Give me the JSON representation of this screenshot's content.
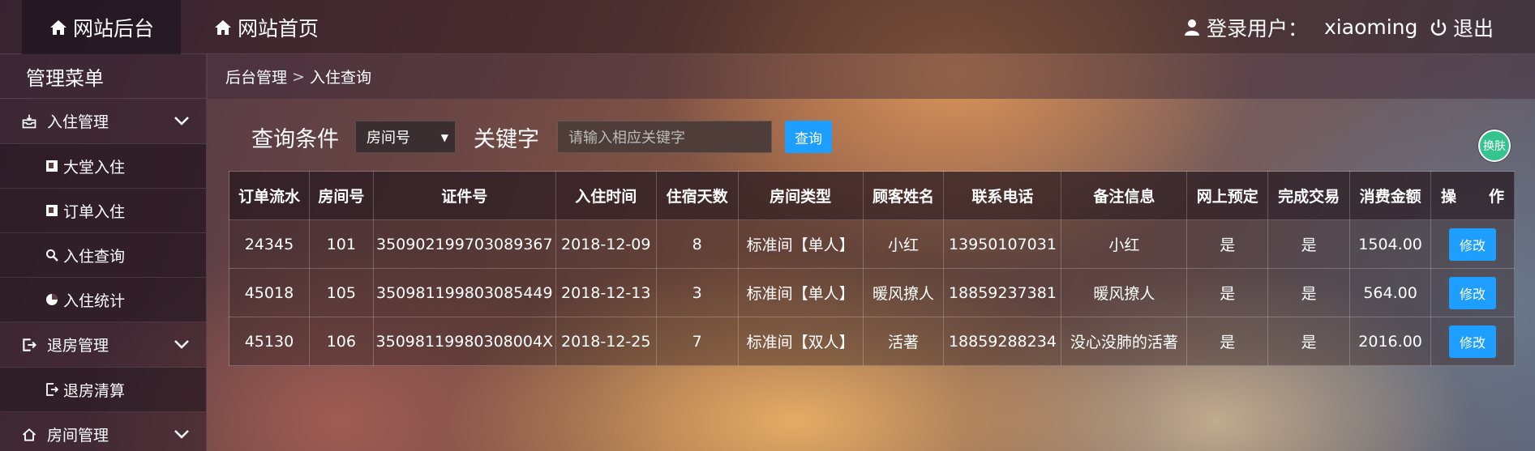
{
  "topbar": {
    "home_tab": "网站后台",
    "site_tab": "网站首页",
    "user_label": "登录用户：",
    "username": "xiaoming",
    "logout": "退出"
  },
  "sidebar": {
    "title": "管理菜单",
    "groups": [
      {
        "label": "入住管理",
        "items": [
          "大堂入住",
          "订单入住",
          "入住查询",
          "入住统计"
        ]
      },
      {
        "label": "退房管理",
        "items": [
          "退房清算"
        ]
      },
      {
        "label": "房间管理",
        "items": []
      }
    ]
  },
  "breadcrumb": {
    "root": "后台管理",
    "sep": ">",
    "current": "入住查询"
  },
  "query": {
    "label": "查询条件",
    "select_value": "房间号",
    "keyword_label": "关键字",
    "placeholder": "请输入相应关键字",
    "button": "查询"
  },
  "skin_button": "换肤",
  "table": {
    "headers": [
      "订单流水",
      "房间号",
      "证件号",
      "入住时间",
      "住宿天数",
      "房间类型",
      "顾客姓名",
      "联系电话",
      "备注信息",
      "网上预定",
      "完成交易",
      "消费金额"
    ],
    "op_header": [
      "操",
      "作"
    ],
    "edit_label": "修改",
    "rows": [
      [
        "24345",
        "101",
        "350902199703089367",
        "2018-12-09",
        "8",
        "标准间【单人】",
        "小红",
        "13950107031",
        "小红",
        "是",
        "是",
        "1504.00"
      ],
      [
        "45018",
        "105",
        "350981199803085449",
        "2018-12-13",
        "3",
        "标准间【单人】",
        "暖风撩人",
        "18859237381",
        "暖风撩人",
        "是",
        "是",
        "564.00"
      ],
      [
        "45130",
        "106",
        "35098119980308004X",
        "2018-12-25",
        "7",
        "标准间【双人】",
        "活著",
        "18859288234",
        "没心没肺的活著",
        "是",
        "是",
        "2016.00"
      ]
    ]
  },
  "colors": {
    "accent": "#1e9fff",
    "skin": "#35c48f"
  }
}
